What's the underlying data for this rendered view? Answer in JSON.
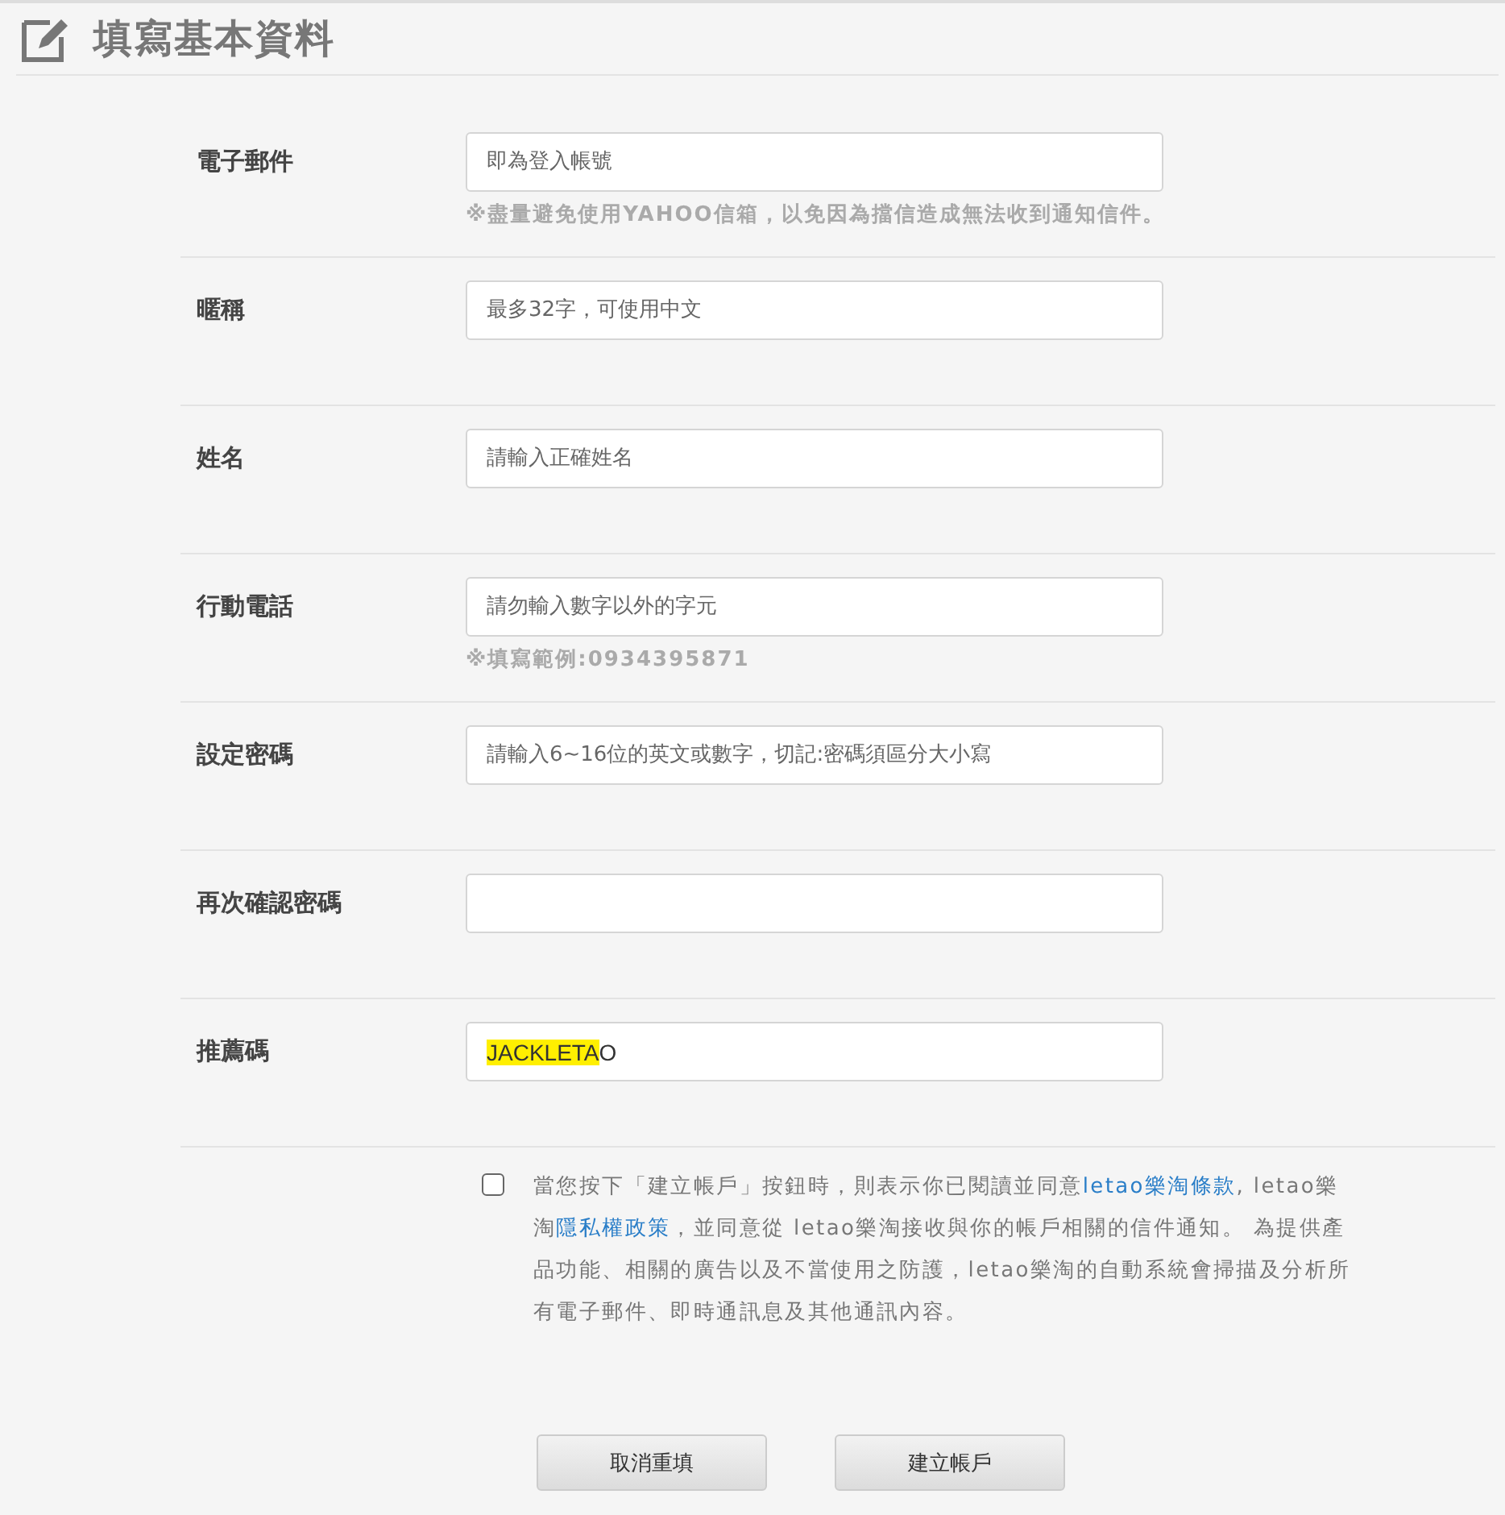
{
  "header": {
    "title": "填寫基本資料"
  },
  "fields": [
    {
      "label": "電子郵件",
      "placeholder": "即為登入帳號",
      "hint": "※盡量避免使用YAHOO信箱，以免因為擋信造成無法收到通知信件。"
    },
    {
      "label": "暱稱",
      "placeholder": "最多32字，可使用中文"
    },
    {
      "label": "姓名",
      "placeholder": "請輸入正確姓名"
    },
    {
      "label": "行動電話",
      "placeholder": "請勿輸入數字以外的字元",
      "hint": "※填寫範例:0934395871"
    },
    {
      "label": "設定密碼",
      "placeholder": "請輸入6~16位的英文或數字，切記:密碼須區分大小寫"
    },
    {
      "label": "再次確認密碼"
    },
    {
      "label": "推薦碼",
      "value_parts": [
        {
          "text": "JACKLETA",
          "highlighted": true
        },
        {
          "text": "O",
          "highlighted": false
        }
      ]
    }
  ],
  "consent": {
    "checked": false,
    "parts": [
      {
        "text": "當您按下「建立帳戶」按鈕時，則表示你已閱讀並同意",
        "link": false
      },
      {
        "text": "letao樂淘條款",
        "link": true
      },
      {
        "text": ", letao樂淘",
        "link": false
      },
      {
        "text": "隱私權政策",
        "link": true
      },
      {
        "text": "，並同意從 letao樂淘接收與你的帳戶相關的信件通知。 為提供產品功能、相關的廣告以及不當使用之防護，letao樂淘的自動系統會掃描及分析所有電子郵件、即時通訊息及其他通訊內容。",
        "link": false
      }
    ]
  },
  "buttons": [
    {
      "label": "取消重填"
    },
    {
      "label": "建立帳戶"
    }
  ]
}
